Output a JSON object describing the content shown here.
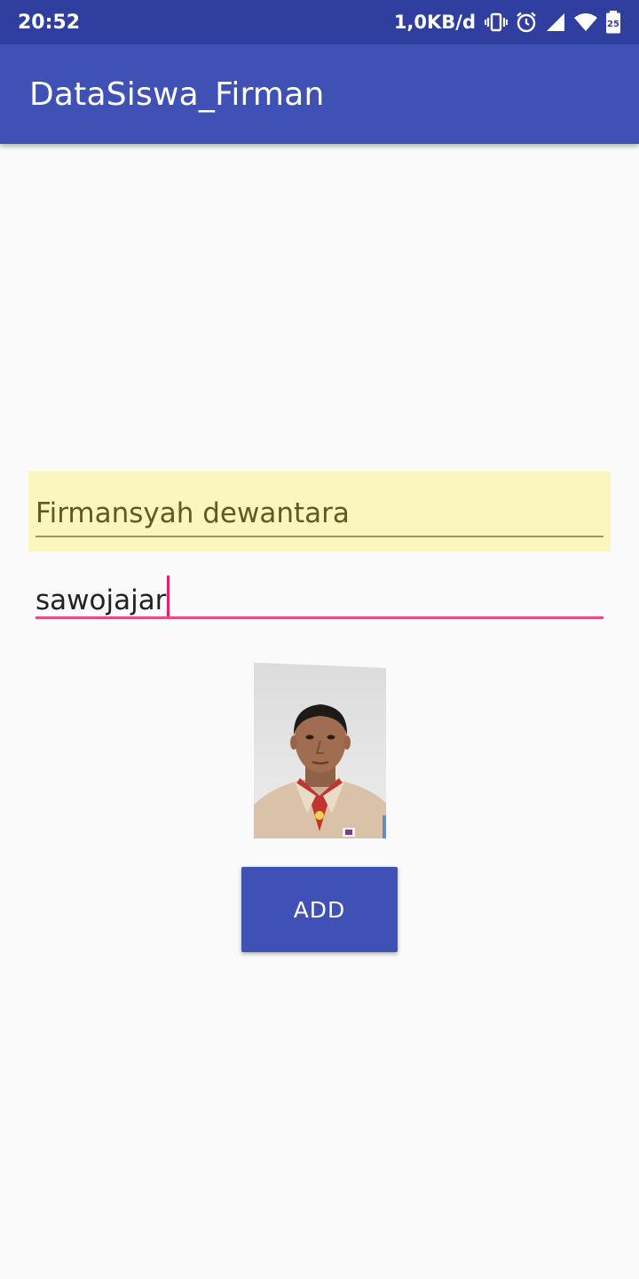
{
  "status_bar": {
    "time": "20:52",
    "network_speed": "1,0KB/d",
    "battery_level": "25",
    "icons": [
      "vibrate-icon",
      "alarm-icon",
      "cell-signal-icon",
      "wifi-icon",
      "battery-icon"
    ],
    "background_color": "#303f9f"
  },
  "app_bar": {
    "title": "DataSiswa_Firman",
    "background_color": "#3f51b5"
  },
  "form": {
    "name_value": "Firmansyah dewantara",
    "address_value": "sawojajar",
    "accent_color": "#e91e63",
    "autofill_highlight_color": "#fbf6be"
  },
  "student_photo": {
    "icon": "student-photo"
  },
  "add_button": {
    "label": "ADD"
  }
}
